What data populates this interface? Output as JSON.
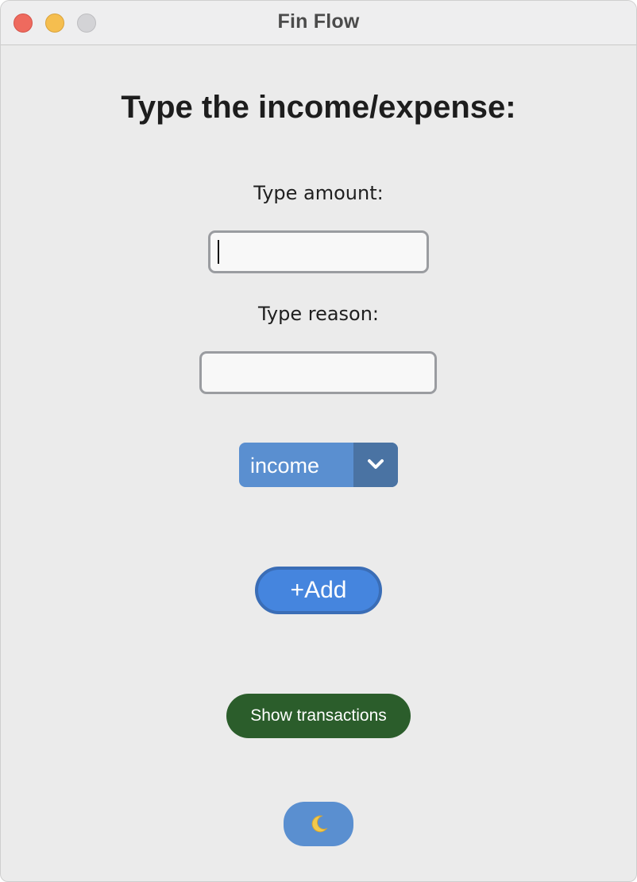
{
  "window": {
    "title": "Fin Flow"
  },
  "form": {
    "heading": "Type the income/expense:",
    "amount_label": "Type amount:",
    "amount_value": "",
    "reason_label": "Type reason:",
    "reason_value": "",
    "type_select": {
      "selected": "income"
    },
    "add_label": "+Add",
    "show_transactions_label": "Show transactions",
    "theme_toggle_icon": "moon-icon"
  },
  "colors": {
    "accent_blue": "#4585de",
    "select_blue": "#5a8fd0",
    "show_button_green": "#2b5d2b",
    "close": "#ee6a5e",
    "minimize": "#f5be4f"
  }
}
